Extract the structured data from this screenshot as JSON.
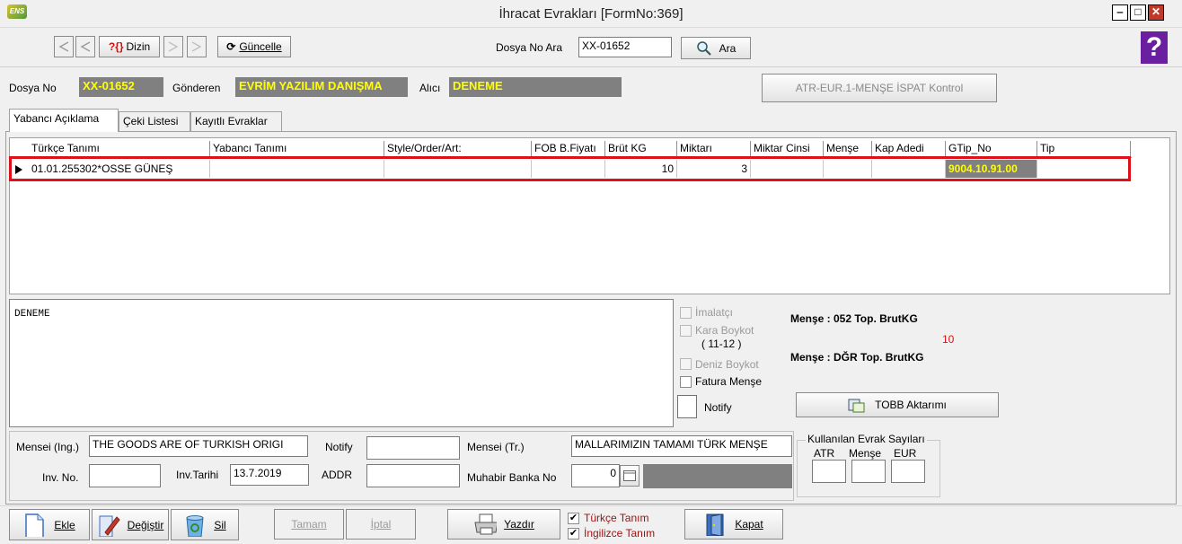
{
  "window": {
    "title": "İhracat Evrakları [FormNo:369]",
    "app_icon_text": "ENS",
    "minimize": "‒",
    "maximize": "□",
    "close": "✕"
  },
  "toolbar": {
    "dizin_label": "Dizin",
    "dizin_icon_text": "?{}",
    "guncelle_label": "Güncelle",
    "guncelle_icon_text": "⟳",
    "dosya_no_ara_label": "Dosya No Ara",
    "dosya_no_ara_value": "XX-01652",
    "ara_label": "Ara",
    "help_text": "?"
  },
  "header": {
    "dosya_no_label": "Dosya No",
    "dosya_no_value": "XX-01652",
    "gonderen_label": "Gönderen",
    "gonderen_value": "EVRİM YAZILIM DANIŞMA",
    "alici_label": "Alıcı",
    "alici_value": "DENEME",
    "atr_button_label": "ATR-EUR.1-MENŞE İSPAT Kontrol"
  },
  "tabs": [
    {
      "label": "Yabancı Açıklama",
      "active": true
    },
    {
      "label": "Çeki Listesi",
      "active": false
    },
    {
      "label": "Kayıtlı Evraklar",
      "active": false
    }
  ],
  "grid": {
    "columns": [
      "Türkçe Tanımı",
      "Yabancı Tanımı",
      "Style/Order/Art:",
      "FOB B.Fiyatı",
      "Brüt KG",
      "Miktarı",
      "Miktar Cinsi",
      "Menşe",
      "Kap Adedi",
      "GTip_No",
      "Tip"
    ],
    "rows": [
      {
        "turkce_tanimi": "01.01.255302*OSSE GÜNEŞ",
        "yabanci_tanimi": "",
        "style_order": "",
        "fob": "",
        "brut_kg": "10",
        "miktari": "3",
        "miktar_cinsi": "",
        "mense": "",
        "kap_adedi": "",
        "gtip_no": "9004.10.91.00",
        "tip": ""
      }
    ]
  },
  "description_text": "DENEME",
  "checks": {
    "imalatci": {
      "label": "İmalatçı",
      "checked": false
    },
    "kara_boykot": {
      "label": "Kara Boykot",
      "sub": "( 11-12 )",
      "checked": false
    },
    "deniz_boykot": {
      "label": "Deniz Boykot",
      "checked": false
    },
    "fatura_mense": {
      "label": "Fatura Menşe",
      "checked": false
    },
    "notify": {
      "label": "Notify"
    }
  },
  "mense_summary": {
    "line1": "Menşe : 052  Top. BrutKG",
    "value1": "10",
    "line2": "Menşe : DĞR  Top. BrutKG"
  },
  "tobb_button_label": "TOBB Aktarımı",
  "form": {
    "mensei_ing_label": "Mensei (Ing.)",
    "mensei_ing_value": "THE GOODS ARE OF TURKISH ORIGI",
    "notify_label": "Notify",
    "notify_value": "",
    "mensei_tr_label": "Mensei (Tr.)",
    "mensei_tr_value": "MALLARIMIZIN TAMAMI TÜRK MENŞE",
    "inv_no_label": "Inv. No.",
    "inv_no_value": "",
    "inv_tarihi_label": "Inv.Tarihi",
    "inv_tarihi_value": "13.7.2019",
    "addr_label": "ADDR",
    "addr_value": "",
    "muhabir_label": "Muhabir Banka No",
    "muhabir_value": "0"
  },
  "evrak_sayilari": {
    "title": "Kullanılan Evrak Sayıları",
    "atr_label": "ATR",
    "mense_label": "Menşe",
    "eur_label": "EUR"
  },
  "bottom": {
    "ekle_label": "Ekle",
    "degistir_label": "Değiştir",
    "sil_label": "Sil",
    "tamam_label": "Tamam",
    "iptal_label": "İptal",
    "yazdir_label": "Yazdır",
    "turkce_tanim_label": "Türkçe Tanım",
    "turkce_tanim_checked": true,
    "ingilizce_tanim_label": "İngilizce Tanım",
    "ingilizce_tanim_checked": true,
    "kapat_label": "Kapat",
    "check_mark": "✔"
  },
  "colors": {
    "highlight_red": "#e0101a",
    "field_bg_gray": "#808080",
    "field_text_yellow": "#ffff00",
    "label_red": "#9b1010",
    "help_purple": "#6a1fa0"
  }
}
